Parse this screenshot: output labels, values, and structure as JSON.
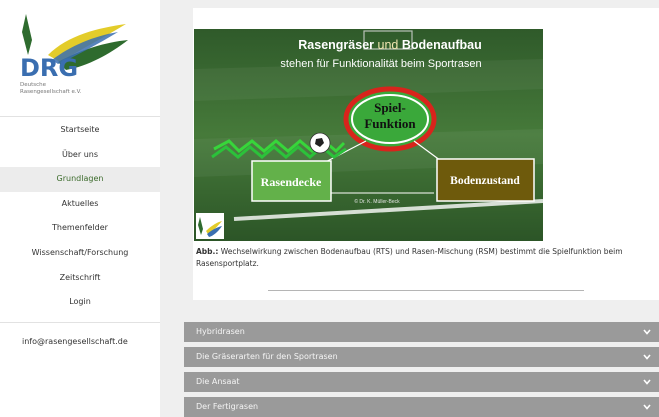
{
  "logo": {
    "mark": "DRG",
    "org_line1": "Deutsche",
    "org_line2": "Rasengesellschaft e.V.",
    "colors": {
      "green": "#2e6b2e",
      "yellow": "#e3cc2a",
      "blue": "#3a6eb0"
    }
  },
  "nav": {
    "items": [
      {
        "label": "Startseite",
        "icon": ""
      },
      {
        "label": "Über uns"
      },
      {
        "label": "Grundlagen",
        "active": true
      },
      {
        "label": "Aktuelles"
      },
      {
        "label": "Themenfelder"
      },
      {
        "label": "Wissenschaft/Forschung"
      },
      {
        "label": "Zeitschrift"
      },
      {
        "label": "Login"
      }
    ],
    "contact_email": "info@rasengesellschaft.de"
  },
  "figure": {
    "title_line1_a": "Rasengräser",
    "title_line1_b": "und",
    "title_line1_c": "Bodenaufbau",
    "title_line2": "stehen für Funktionalität beim Sportrasen",
    "center_label_1": "Spiel-",
    "center_label_2": "Funktion",
    "left_box": "Rasendecke",
    "right_box": "Bodenzustand",
    "credit": "© Dr. K. Müller-Beck",
    "colors": {
      "red": "#d8241c",
      "green_box": "#63b14a",
      "olive_box": "#6e5a0c",
      "field": "#3d6a33"
    }
  },
  "caption": {
    "prefix": "Abb.:",
    "text": " Wechselwirkung zwischen Bodenaufbau (RTS) und Rasen-Mischung (RSM) bestimmt die Spielfunktion beim Rasensportplatz."
  },
  "accordion": [
    {
      "label": "Hybridrasen"
    },
    {
      "label": "Die Gräserarten für den Sportrasen"
    },
    {
      "label": "Die Ansaat"
    },
    {
      "label": "Der Fertigrasen"
    }
  ]
}
